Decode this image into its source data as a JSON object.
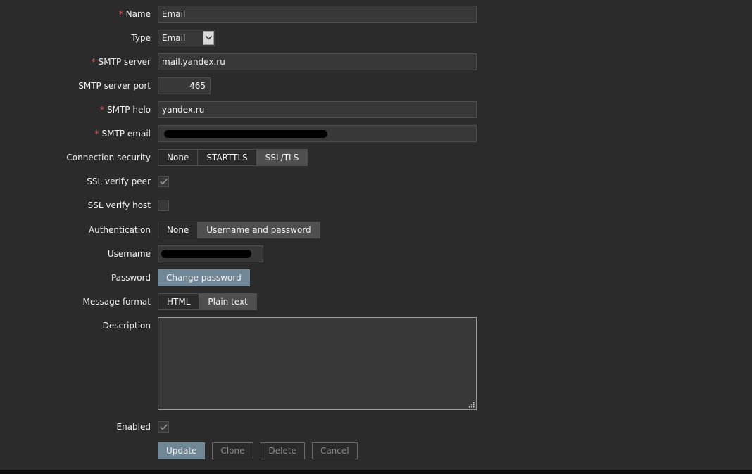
{
  "form": {
    "name": {
      "label": "Name",
      "required": "*",
      "value": "Email"
    },
    "type": {
      "label": "Type",
      "value": "Email",
      "icon": "chevron-down-icon"
    },
    "smtp_server": {
      "label": "SMTP server",
      "required": "*",
      "value": "mail.yandex.ru"
    },
    "smtp_port": {
      "label": "SMTP server port",
      "value": "465"
    },
    "smtp_helo": {
      "label": "SMTP helo",
      "required": "*",
      "value": "yandex.ru"
    },
    "smtp_email": {
      "label": "SMTP email",
      "required": "*",
      "value": "",
      "redacted": true
    },
    "connection_security": {
      "label": "Connection security",
      "options": [
        "None",
        "STARTTLS",
        "SSL/TLS"
      ],
      "selected": "SSL/TLS"
    },
    "ssl_verify_peer": {
      "label": "SSL verify peer",
      "checked": true
    },
    "ssl_verify_host": {
      "label": "SSL verify host",
      "checked": false
    },
    "authentication": {
      "label": "Authentication",
      "options": [
        "None",
        "Username and password"
      ],
      "selected": "Username and password"
    },
    "username": {
      "label": "Username",
      "value": "",
      "redacted": true
    },
    "password": {
      "label": "Password",
      "button": "Change password"
    },
    "message_format": {
      "label": "Message format",
      "options": [
        "HTML",
        "Plain text"
      ],
      "selected": "Plain text"
    },
    "description": {
      "label": "Description",
      "value": ""
    },
    "enabled": {
      "label": "Enabled",
      "checked": true
    }
  },
  "actions": {
    "update": "Update",
    "clone": "Clone",
    "delete": "Delete",
    "cancel": "Cancel"
  },
  "colors": {
    "background": "#2b2b2b",
    "input_bg": "#383838",
    "border": "#4f4f4f",
    "required": "#e45959",
    "primary_button": "#6f8797",
    "selected_segment": "#4f4f4f"
  }
}
